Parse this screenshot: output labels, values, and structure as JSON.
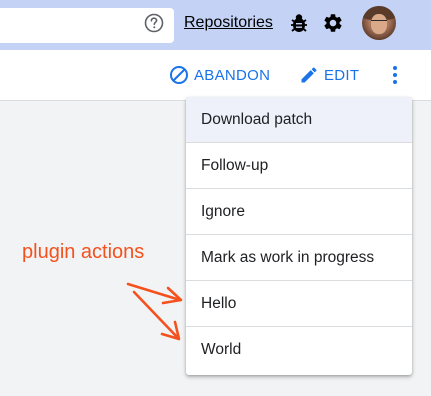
{
  "header": {
    "repositories_label": "Repositories",
    "icons": [
      "help-icon",
      "bug-icon",
      "gear-icon",
      "avatar"
    ]
  },
  "actions": {
    "abandon_label": "ABANDON",
    "edit_label": "EDIT",
    "accent_color": "#1a73e8"
  },
  "menu": {
    "items": [
      {
        "label": "Download patch"
      },
      {
        "label": "Follow-up"
      },
      {
        "label": "Ignore"
      },
      {
        "label": "Mark as work in progress"
      },
      {
        "label": "Hello"
      },
      {
        "label": "World"
      }
    ]
  },
  "annotation": {
    "text": "plugin actions",
    "color": "#f4511e"
  },
  "colors": {
    "header_bg": "#c3d2f5",
    "page_bg": "#f1f3f4"
  }
}
